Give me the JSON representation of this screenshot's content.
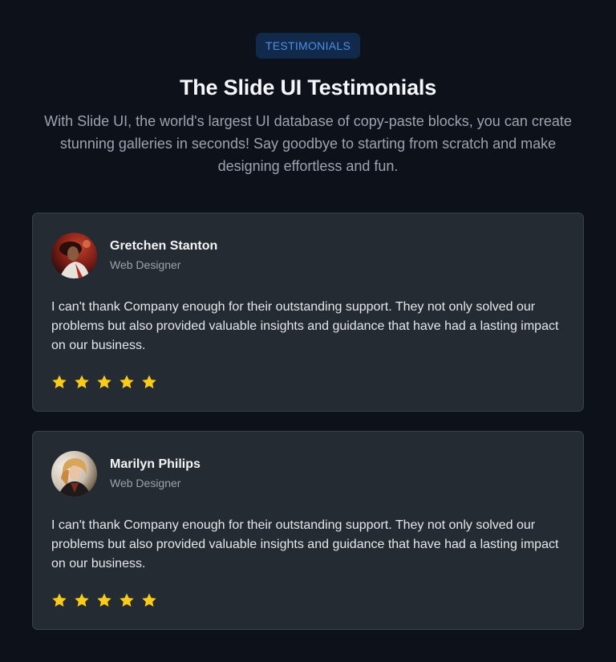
{
  "header": {
    "badge": "TESTIMONIALS",
    "title": "The Slide UI Testimonials",
    "subtitle": "With Slide UI, the world's largest UI database of copy-paste blocks, you can create stunning galleries in seconds! Say goodbye to starting from scratch and make designing effortless and fun."
  },
  "testimonials": [
    {
      "name": "Gretchen Stanton",
      "role": "Web Designer",
      "quote": "I can't thank Company enough for their outstanding support. They not only solved our problems but also provided valuable insights and guidance that have had a lasting impact on our business.",
      "rating": 5
    },
    {
      "name": "Marilyn Philips",
      "role": "Web Designer",
      "quote": "I can't thank Company enough for their outstanding support. They not only solved our problems but also provided valuable insights and guidance that have had a lasting impact on our business.",
      "rating": 5
    }
  ],
  "colors": {
    "background": "#0d111a",
    "card": "#252b33",
    "badge_bg": "#11294a",
    "badge_text": "#4f8fe0",
    "star": "#facc15"
  },
  "icons": {
    "star": "star-icon"
  }
}
